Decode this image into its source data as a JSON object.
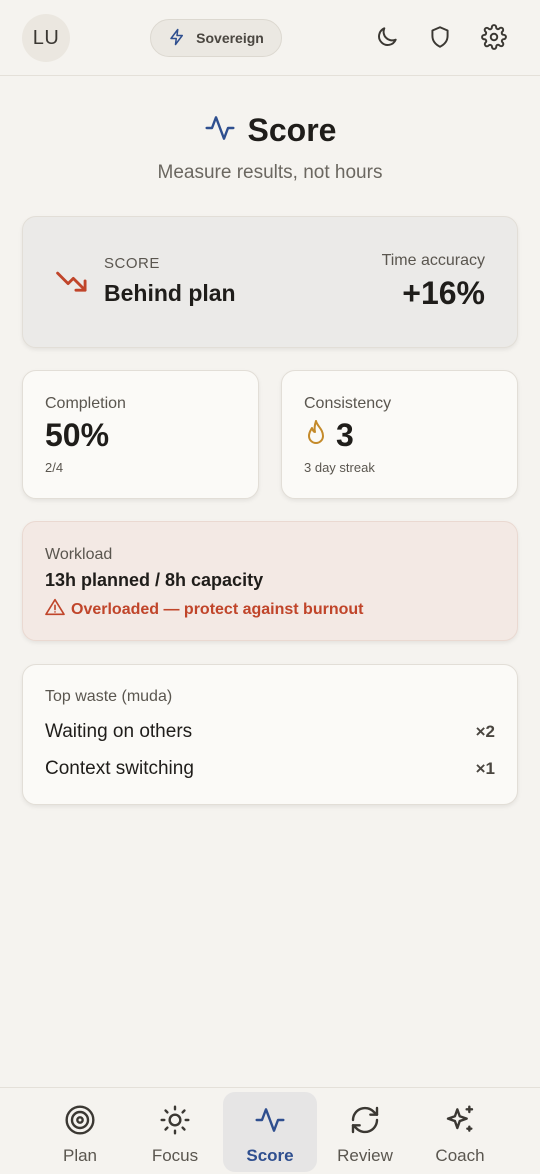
{
  "topbar": {
    "avatar_initials": "LU",
    "mode_label": "Sovereign",
    "icons": [
      "zap-icon",
      "moon-icon",
      "shield-icon",
      "gear-icon"
    ]
  },
  "header": {
    "title": "Score",
    "subtitle": "Measure results, not hours"
  },
  "score_card": {
    "label": "SCORE",
    "status": "Behind plan",
    "accuracy_label": "Time accuracy",
    "accuracy_value": "+16%"
  },
  "completion": {
    "label": "Completion",
    "value": "50%",
    "sub": "2/4"
  },
  "consistency": {
    "label": "Consistency",
    "value": "3",
    "sub": "3 day streak"
  },
  "workload": {
    "label": "Workload",
    "value": "13h planned / 8h capacity",
    "warning": "Overloaded — protect against burnout"
  },
  "waste": {
    "label": "Top waste (muda)",
    "items": [
      {
        "name": "Waiting on others",
        "count": "×2"
      },
      {
        "name": "Context switching",
        "count": "×1"
      }
    ]
  },
  "nav": {
    "items": [
      {
        "label": "Plan",
        "icon": "target-icon"
      },
      {
        "label": "Focus",
        "icon": "sun-icon"
      },
      {
        "label": "Score",
        "icon": "activity-icon"
      },
      {
        "label": "Review",
        "icon": "refresh-icon"
      },
      {
        "label": "Coach",
        "icon": "sparkles-icon"
      }
    ],
    "active": "Score"
  },
  "colors": {
    "accent": "#2f4f8f",
    "danger": "#c0452a",
    "streak": "#c48a2a",
    "background": "#f5f3ef"
  }
}
